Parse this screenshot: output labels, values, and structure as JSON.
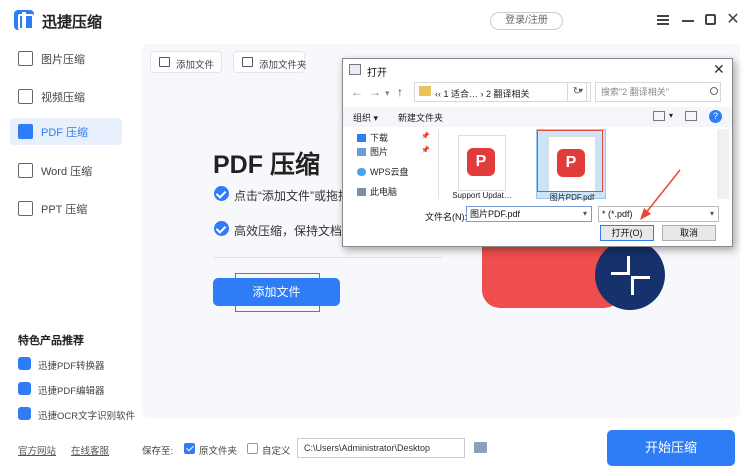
{
  "app": {
    "title": "迅捷压缩",
    "login_label": "登录/注册"
  },
  "sidebar": {
    "items": [
      {
        "label": "图片压缩",
        "icon": "image-icon"
      },
      {
        "label": "视频压缩",
        "icon": "video-icon"
      },
      {
        "label": "PDF 压缩",
        "icon": "pdf-icon"
      },
      {
        "label": "Word 压缩",
        "icon": "word-icon"
      },
      {
        "label": "PPT 压缩",
        "icon": "ppt-icon"
      }
    ],
    "active_index": 2,
    "featured_title": "特色产品推荐",
    "featured": [
      {
        "label": "迅捷PDF转换器"
      },
      {
        "label": "迅捷PDF编辑器"
      },
      {
        "label": "迅捷OCR文字识别软件"
      }
    ],
    "links": [
      "官方网站",
      "在线客服"
    ]
  },
  "toolbar": {
    "add_file": "添加文件",
    "add_folder": "添加文件夹"
  },
  "main": {
    "title": "PDF 压缩",
    "features": [
      "点击“添加文件”或拖拽",
      "高效压缩，保持文档质量"
    ],
    "add_file_button": "添加文件"
  },
  "bottom": {
    "save_to_label": "保存至:",
    "option_original": "原文件夹",
    "option_original_checked": true,
    "option_custom": "自定义",
    "option_custom_checked": false,
    "path_value": "C:\\Users\\Administrator\\Desktop",
    "start_button": "开始压缩"
  },
  "dialog": {
    "title": "打开",
    "path_parts": "‹‹  1 适合…  ›  2 翻译相关",
    "search_placeholder": "搜索\"2 翻译相关\"",
    "organize": "组织 ▾",
    "new_folder": "新建文件夹",
    "help": "?",
    "tree": [
      {
        "label": "下载",
        "icon": "download-icon"
      },
      {
        "label": "图片",
        "icon": "pictures-icon"
      },
      {
        "label": "WPS云盘",
        "icon": "cloud-icon"
      },
      {
        "label": "此电脑",
        "icon": "computer-icon"
      }
    ],
    "files": [
      {
        "name": "Support Updat…",
        "selected": false
      },
      {
        "name": "图片PDF.pdf",
        "selected": true
      }
    ],
    "filename_label": "文件名(N):",
    "filename_value": "图片PDF.pdf",
    "filetype_value": "* (*.pdf)",
    "open_button": "打开(O)",
    "cancel_button": "取消"
  },
  "colors": {
    "accent": "#2f7df6",
    "highlight": "#e8473a",
    "pdf_red": "#ee4e4e"
  }
}
